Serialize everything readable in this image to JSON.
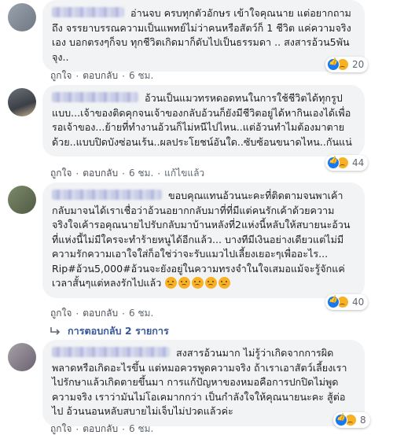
{
  "comments": [
    {
      "text": "อ่านจบ ครบทุกตัวอักษร เข้าใจคุณนาย แต่อยากถามถึง จรรยาบรรณความเป็นแพทย์ไม่ว่าคนหรือสัตว์ก็ 1 ชีวิต แค่ความจริงเอง บอกตรงๆก็จบ ทุกชีวิตเกิดมาก็ดับไปเป็นธรรมดา .. สงสารอ้วน5พันจุง..",
      "reactions": "20",
      "actions": [
        "ถูกใจ",
        "ตอบกลับ",
        "6 ชม."
      ]
    },
    {
      "text": "อ้วนเป็นแมวทรหดอดทนในการใช้ชีวิตได้ทุกรูปแบบ...เจ้าของติดคุกจนเจ้าของกลับอ้วนก็ยังมีชีวิตอยู่ได้หากินเองได้เพื่อรอเจ้าของ...ย้ายที่ทำงานอ้วนก็ไม่หนีไปไหน..แต่อ้วนทำไมต้องมาตายด้วย..แบบปิดบังซ่อนเร้น..ผลประโยชน์อันใด..ซับซ้อนขนาดไหน..กันแน่",
      "reactions": "44",
      "actions": [
        "ถูกใจ",
        "ตอบกลับ",
        "6 ชม.",
        "แก้ไขแล้ว"
      ]
    },
    {
      "text": "ขอบคุณแทนอ้วนนะคะที่ติดตามจนพาเค้ากลับมาจนได้เราเชื่อว่าอ้วนอยากกลับมาที่ที่มีแต่คนรักเค้าด้วยความจริงใจเค้ารอคุณนายไปรับกลับมาบ้านหลังที่2แห่งนี้หลับให้สบายนะอ้วนที่แห่งนี้ไม่มีใครจะทำร้ายหนูได้อีกแล้ว... บางทีมีเงินอย่างเดียวแต่ไม่มีความรักความเอาใจใส่ก็อใช่ว่าจะรับแมวไปเลี้ยงเยอะๆเพื่ออะไร... Rip#อ้วน5,000#อ้วนจะยังอยู่ในความทรงจำในใจเสมอแม้จะรู้จักแค่เวลาสั้นๆแต่หลงรักไปแล้ว",
      "reactions": "40",
      "actions": [
        "ถูกใจ",
        "ตอบกลับ",
        "6 ชม."
      ]
    },
    {
      "text": "สงสารอ้วนมาก ไม่รู้ว่าเกิดจากการผิดพลาดหรือเกิดอะไรขึ้น แต่หมอควรพูดความจริง ถ้าเราเอาสัตว์เลี้ยงเราไปรักษาแล้วเกิดตายขึ้นมา การแก้ปัญหาของหมอคือการปกปิดไม่พูดความจริง เราว่ามันไม่โอเคมากกว่า เป็นกำลังใจให้คุณนายนะคะ สู้ต่อไป อ้วนนอนหลับสบายไม่เจ็บไม่ปวดแล้วค่ะ",
      "reactions": "8",
      "actions": [
        "ถูกใจ",
        "ตอบกลับ",
        "6 ชม."
      ]
    }
  ],
  "replies_link": "การตอบกลับ 2 รายการ",
  "colors": {
    "bubble": "#f2f3f5",
    "link": "#385898",
    "meta": "#606770",
    "like_blue": "#1877f2",
    "sad_yellow": "#f7b125"
  },
  "icons": [
    "like-reaction-icon",
    "sad-reaction-icon",
    "reply-arrow-icon"
  ]
}
